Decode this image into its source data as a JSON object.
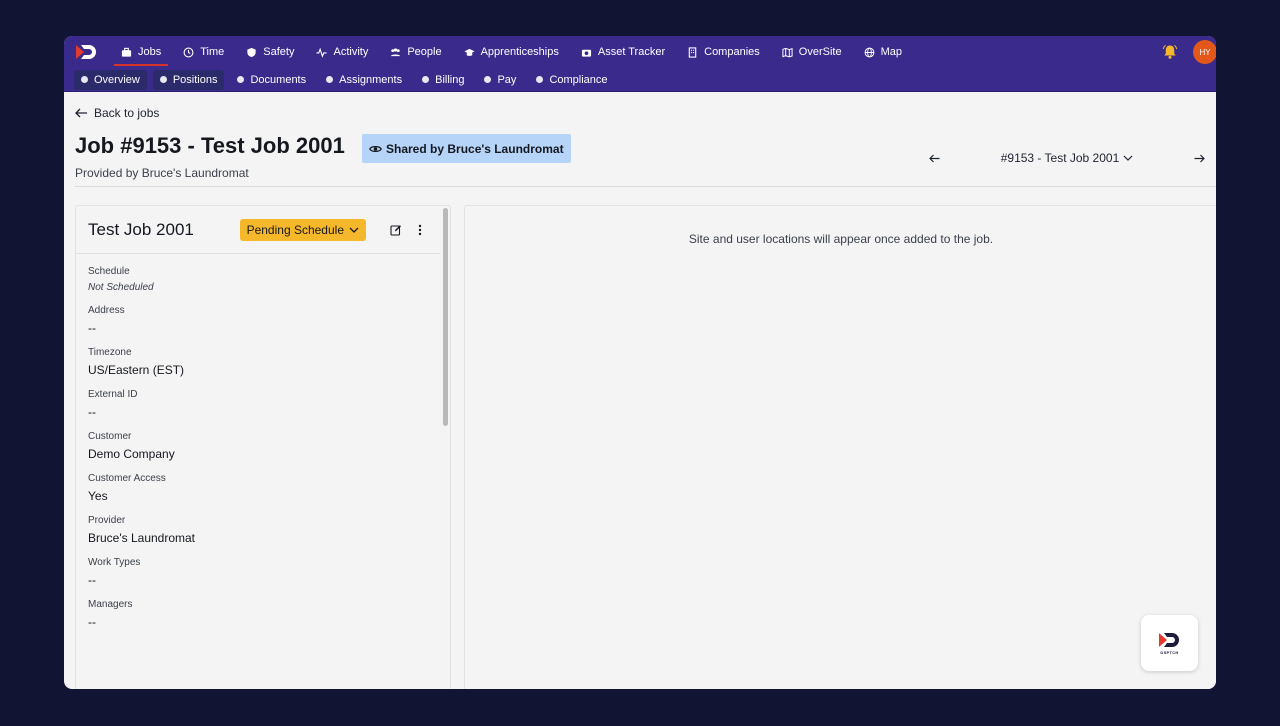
{
  "nav": {
    "items": [
      {
        "label": "Jobs",
        "icon": "briefcase-icon",
        "active": true
      },
      {
        "label": "Time",
        "icon": "clock-icon"
      },
      {
        "label": "Safety",
        "icon": "shield-icon"
      },
      {
        "label": "Activity",
        "icon": "activity-icon"
      },
      {
        "label": "People",
        "icon": "people-icon"
      },
      {
        "label": "Apprenticeships",
        "icon": "graduation-cap-icon"
      },
      {
        "label": "Asset Tracker",
        "icon": "camera-icon"
      },
      {
        "label": "Companies",
        "icon": "building-icon"
      },
      {
        "label": "OverSite",
        "icon": "map-book-icon"
      },
      {
        "label": "Map",
        "icon": "globe-icon"
      }
    ],
    "avatar_initials": "HY",
    "accent_color": "#3a2a8c"
  },
  "subnav": {
    "items": [
      {
        "label": "Overview"
      },
      {
        "label": "Positions"
      },
      {
        "label": "Documents"
      },
      {
        "label": "Assignments"
      },
      {
        "label": "Billing"
      },
      {
        "label": "Pay"
      },
      {
        "label": "Compliance"
      }
    ]
  },
  "header": {
    "back_label": "Back to jobs",
    "title": "Job #9153 - Test Job 2001",
    "shared_badge": "Shared by Bruce's Laundromat",
    "subtitle": "Provided by Bruce's Laundromat",
    "job_selector": "#9153 - Test Job 2001"
  },
  "panel": {
    "title": "Test Job 2001",
    "status": "Pending Schedule",
    "status_color": "#f5b82a",
    "fields": [
      {
        "label": "Schedule",
        "value": "Not Scheduled",
        "italic": true
      },
      {
        "label": "Address",
        "value": "--"
      },
      {
        "label": "Timezone",
        "value": "US/Eastern (EST)"
      },
      {
        "label": "External ID",
        "value": "--"
      },
      {
        "label": "Customer",
        "value": "Demo Company"
      },
      {
        "label": "Customer Access",
        "value": "Yes"
      },
      {
        "label": "Provider",
        "value": "Bruce's Laundromat"
      },
      {
        "label": "Work Types",
        "value": "--"
      },
      {
        "label": "Managers",
        "value": "--"
      }
    ]
  },
  "map": {
    "message": "Site and user locations will appear once added to the job."
  },
  "chat": {
    "label": "DSPTCH"
  }
}
